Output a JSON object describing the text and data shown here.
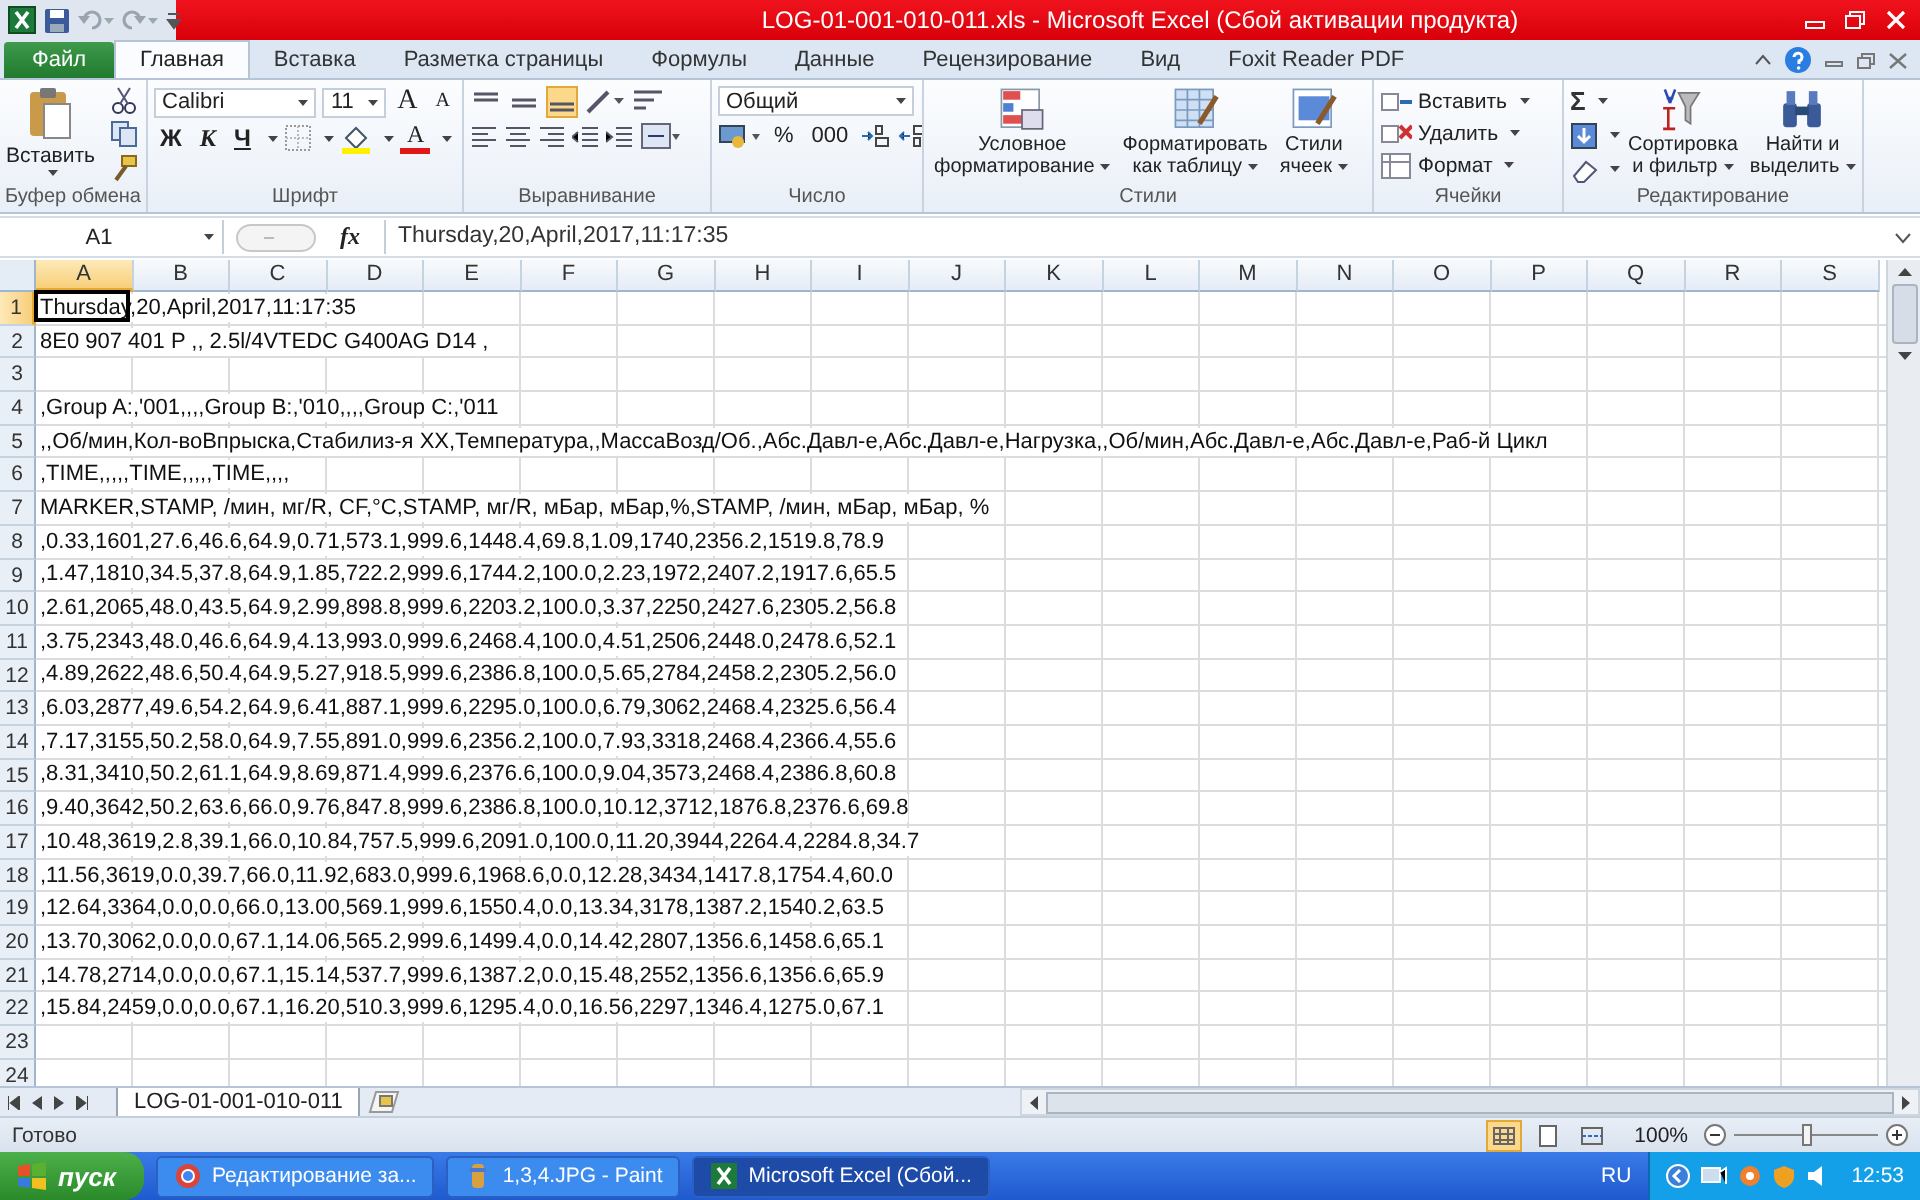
{
  "title_bar": {
    "title": "LOG-01-001-010-011.xls  -  Microsoft Excel (Сбой активации продукта)"
  },
  "tabs": [
    {
      "label": "Файл",
      "kind": "file",
      "selected": false
    },
    {
      "label": "Главная",
      "kind": "tab",
      "selected": true
    },
    {
      "label": "Вставка",
      "kind": "tab",
      "selected": false
    },
    {
      "label": "Разметка страницы",
      "kind": "tab",
      "selected": false
    },
    {
      "label": "Формулы",
      "kind": "tab",
      "selected": false
    },
    {
      "label": "Данные",
      "kind": "tab",
      "selected": false
    },
    {
      "label": "Рецензирование",
      "kind": "tab",
      "selected": false
    },
    {
      "label": "Вид",
      "kind": "tab",
      "selected": false
    },
    {
      "label": "Foxit Reader PDF",
      "kind": "tab",
      "selected": false
    }
  ],
  "ribbon": {
    "clipboard": {
      "paste": "Вставить",
      "label": "Буфер обмена"
    },
    "font": {
      "name": "Calibri",
      "size": "11",
      "grow": "A",
      "shrink": "A",
      "bold": "Ж",
      "italic": "К",
      "underline": "Ч",
      "text_color": "A",
      "label": "Шрифт"
    },
    "alignment": {
      "vertical": [
        {
          "selected": false
        },
        {
          "selected": false
        },
        {
          "selected": true
        }
      ],
      "label": "Выравнивание"
    },
    "number": {
      "format": "Общий",
      "percent": "%",
      "thousands": "000",
      "label": "Число"
    },
    "styles": {
      "buttons": [
        [
          "Условное",
          "форматирование"
        ],
        [
          "Форматировать",
          "как таблицу"
        ],
        [
          "Стили",
          "ячеек"
        ]
      ],
      "label": "Стили"
    },
    "cells": {
      "buttons": [
        "Вставить",
        "Удалить",
        "Формат"
      ],
      "label": "Ячейки"
    },
    "editing": {
      "sum": "Σ",
      "buttons": [
        [
          "Сортировка",
          "и фильтр"
        ],
        [
          "Найти и",
          "выделить"
        ]
      ],
      "label": "Редактирование"
    }
  },
  "formula_bar": {
    "name_box": "A1",
    "function_label": "fx",
    "value": "Thursday,20,April,2017,11:17:35"
  },
  "columns": [
    {
      "label": "A",
      "selected": true
    },
    {
      "label": "B",
      "selected": false
    },
    {
      "label": "C",
      "selected": false
    },
    {
      "label": "D",
      "selected": false
    },
    {
      "label": "E",
      "selected": false
    },
    {
      "label": "F",
      "selected": false
    },
    {
      "label": "G",
      "selected": false
    },
    {
      "label": "H",
      "selected": false
    },
    {
      "label": "I",
      "selected": false
    },
    {
      "label": "J",
      "selected": false
    },
    {
      "label": "K",
      "selected": false
    },
    {
      "label": "L",
      "selected": false
    },
    {
      "label": "M",
      "selected": false
    },
    {
      "label": "N",
      "selected": false
    },
    {
      "label": "O",
      "selected": false
    },
    {
      "label": "P",
      "selected": false
    },
    {
      "label": "Q",
      "selected": false
    },
    {
      "label": "R",
      "selected": false
    },
    {
      "label": "S",
      "selected": false
    }
  ],
  "rows": [
    {
      "number": "1",
      "selected": true,
      "text": "Thursday,20,April,2017,11:17:35"
    },
    {
      "number": "2",
      "selected": false,
      "text": "8E0 907 401 P  ,, 2.5l/4VTEDC G400AG D14  ,"
    },
    {
      "number": "3",
      "selected": false
    },
    {
      "number": "4",
      "selected": false,
      "text": ",Group A:,'001,,,,Group B:,'010,,,,Group C:,'011"
    },
    {
      "number": "5",
      "selected": false,
      "text": ",,Об/мин,Кол-воВпрыска,Стабилиз-я ХХ,Температура,,МассаВозд/Об.,Абс.Давл-е,Абс.Давл-е,Нагрузка,,Об/мин,Абс.Давл-е,Абс.Давл-е,Раб-й Цикл"
    },
    {
      "number": "6",
      "selected": false,
      "text": ",TIME,,,,,TIME,,,,,TIME,,,,"
    },
    {
      "number": "7",
      "selected": false,
      "text": "MARKER,STAMP, /мин, мг/R, CF,°C,STAMP, мг/R, мБар, мБар,%,STAMP, /мин, мБар, мБар, %"
    },
    {
      "number": "8",
      "selected": false,
      "text": ",0.33,1601,27.6,46.6,64.9,0.71,573.1,999.6,1448.4,69.8,1.09,1740,2356.2,1519.8,78.9"
    },
    {
      "number": "9",
      "selected": false,
      "text": ",1.47,1810,34.5,37.8,64.9,1.85,722.2,999.6,1744.2,100.0,2.23,1972,2407.2,1917.6,65.5"
    },
    {
      "number": "10",
      "selected": false,
      "text": ",2.61,2065,48.0,43.5,64.9,2.99,898.8,999.6,2203.2,100.0,3.37,2250,2427.6,2305.2,56.8"
    },
    {
      "number": "11",
      "selected": false,
      "text": ",3.75,2343,48.0,46.6,64.9,4.13,993.0,999.6,2468.4,100.0,4.51,2506,2448.0,2478.6,52.1"
    },
    {
      "number": "12",
      "selected": false,
      "text": ",4.89,2622,48.6,50.4,64.9,5.27,918.5,999.6,2386.8,100.0,5.65,2784,2458.2,2305.2,56.0"
    },
    {
      "number": "13",
      "selected": false,
      "text": ",6.03,2877,49.6,54.2,64.9,6.41,887.1,999.6,2295.0,100.0,6.79,3062,2468.4,2325.6,56.4"
    },
    {
      "number": "14",
      "selected": false,
      "text": ",7.17,3155,50.2,58.0,64.9,7.55,891.0,999.6,2356.2,100.0,7.93,3318,2468.4,2366.4,55.6"
    },
    {
      "number": "15",
      "selected": false,
      "text": ",8.31,3410,50.2,61.1,64.9,8.69,871.4,999.6,2376.6,100.0,9.04,3573,2468.4,2386.8,60.8"
    },
    {
      "number": "16",
      "selected": false,
      "text": ",9.40,3642,50.2,63.6,66.0,9.76,847.8,999.6,2386.8,100.0,10.12,3712,1876.8,2376.6,69.8"
    },
    {
      "number": "17",
      "selected": false,
      "text": ",10.48,3619,2.8,39.1,66.0,10.84,757.5,999.6,2091.0,100.0,11.20,3944,2264.4,2284.8,34.7"
    },
    {
      "number": "18",
      "selected": false,
      "text": ",11.56,3619,0.0,39.7,66.0,11.92,683.0,999.6,1968.6,0.0,12.28,3434,1417.8,1754.4,60.0"
    },
    {
      "number": "19",
      "selected": false,
      "text": ",12.64,3364,0.0,0.0,66.0,13.00,569.1,999.6,1550.4,0.0,13.34,3178,1387.2,1540.2,63.5"
    },
    {
      "number": "20",
      "selected": false,
      "text": ",13.70,3062,0.0,0.0,67.1,14.06,565.2,999.6,1499.4,0.0,14.42,2807,1356.6,1458.6,65.1"
    },
    {
      "number": "21",
      "selected": false,
      "text": ",14.78,2714,0.0,0.0,67.1,15.14,537.7,999.6,1387.2,0.0,15.48,2552,1356.6,1356.6,65.9"
    },
    {
      "number": "22",
      "selected": false,
      "text": ",15.84,2459,0.0,0.0,67.1,16.20,510.3,999.6,1295.4,0.0,16.56,2297,1346.4,1275.0,67.1"
    },
    {
      "number": "23",
      "selected": false
    },
    {
      "number": "24",
      "selected": false
    }
  ],
  "sheet_tabs": [
    {
      "label": "LOG-01-001-010-011",
      "selected": true
    }
  ],
  "status_bar": {
    "status": "Готово",
    "views": [
      {
        "selected": true
      },
      {
        "selected": false
      },
      {
        "selected": false
      }
    ],
    "zoom": "100%",
    "zoom_level": {
      "level": 0.5
    }
  },
  "taskbar": {
    "start": "пуск",
    "tasks": [
      {
        "label": "Редактирование за...",
        "kind": "browser",
        "selected": false
      },
      {
        "label": "1,3,4.JPG - Paint",
        "kind": "paint",
        "selected": false
      },
      {
        "label": "Microsoft Excel (Сбой...",
        "kind": "excel",
        "selected": true
      }
    ],
    "language": "RU",
    "time": "12:53"
  }
}
